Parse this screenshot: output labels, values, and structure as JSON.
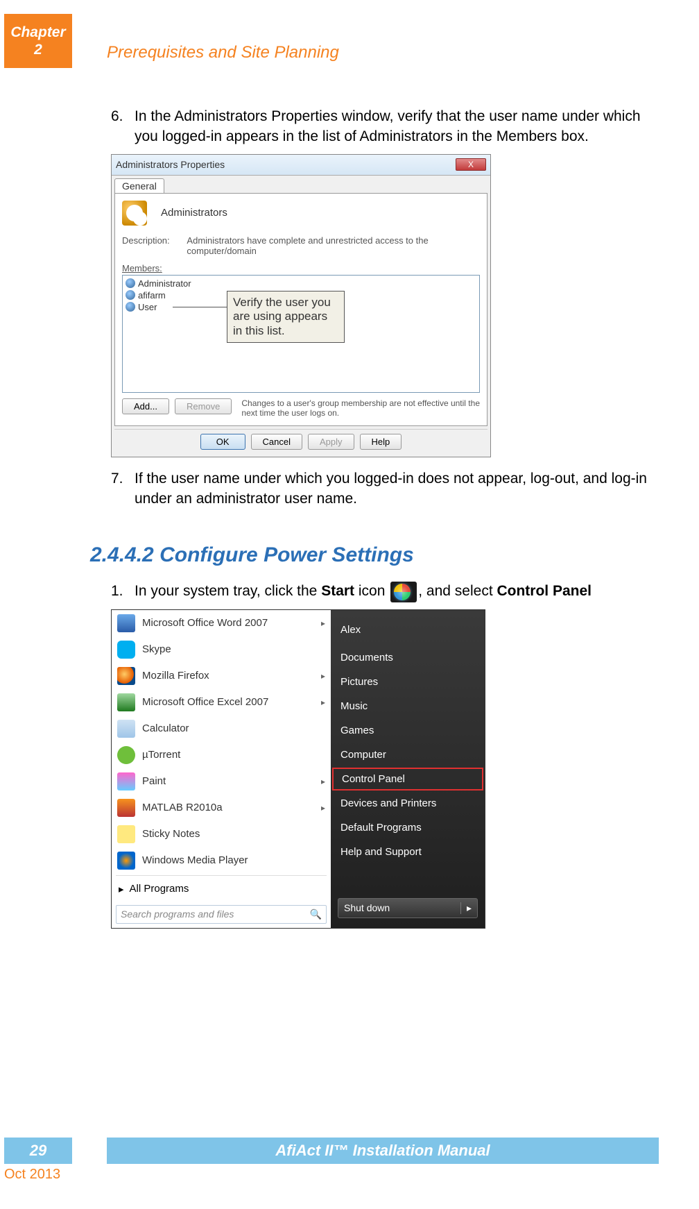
{
  "header": {
    "chapter_label": "Chapter",
    "chapter_num": "2",
    "title": "Prerequisites and Site Planning"
  },
  "step6": {
    "num": "6.",
    "text": "In the Administrators Properties window, verify that the user name under which you logged-in appears in the list of Administrators in the Members box."
  },
  "admin_win": {
    "title": "Administrators Properties",
    "close": "X",
    "tab": "General",
    "group_name": "Administrators",
    "desc_label": "Description:",
    "desc_text": "Administrators have complete and unrestricted access to the computer/domain",
    "members_label": "Members:",
    "members": [
      "Administrator",
      "afifarm",
      "User"
    ],
    "callout": "Verify the user you are using appears in this list.",
    "add": "Add...",
    "remove": "Remove",
    "hint": "Changes to a user's group membership are not effective until the next time the user logs on.",
    "ok": "OK",
    "cancel": "Cancel",
    "apply": "Apply",
    "help": "Help"
  },
  "step7": {
    "num": "7.",
    "text": "If the user name under which you logged-in does not appear, log-out, and log-in under an administrator user name."
  },
  "section": "2.4.4.2 Configure Power Settings",
  "step1": {
    "num": "1.",
    "pre": "In your system tray, click the ",
    "start_bold": "Start",
    "mid": " icon ",
    "post": ", and select ",
    "cp_bold": "Control Panel"
  },
  "start_menu": {
    "left": [
      {
        "label": "Microsoft Office Word 2007",
        "arrow": true,
        "icon": "ic-word"
      },
      {
        "label": "Skype",
        "arrow": false,
        "icon": "ic-skype"
      },
      {
        "label": "Mozilla Firefox",
        "arrow": true,
        "icon": "ic-ff"
      },
      {
        "label": "Microsoft Office Excel 2007",
        "arrow": true,
        "icon": "ic-excel"
      },
      {
        "label": "Calculator",
        "arrow": false,
        "icon": "ic-calc"
      },
      {
        "label": "µTorrent",
        "arrow": false,
        "icon": "ic-ut"
      },
      {
        "label": "Paint",
        "arrow": true,
        "icon": "ic-paint"
      },
      {
        "label": "MATLAB R2010a",
        "arrow": true,
        "icon": "ic-matlab"
      },
      {
        "label": "Sticky Notes",
        "arrow": false,
        "icon": "ic-sticky"
      },
      {
        "label": "Windows Media Player",
        "arrow": false,
        "icon": "ic-wmp"
      }
    ],
    "all_programs": "All Programs",
    "search_placeholder": "Search programs and files",
    "right": [
      {
        "label": "Alex",
        "cls": "user"
      },
      {
        "label": "Documents"
      },
      {
        "label": "Pictures"
      },
      {
        "label": "Music"
      },
      {
        "label": "Games"
      },
      {
        "label": "Computer"
      },
      {
        "label": "Control Panel",
        "cls": "highlight"
      },
      {
        "label": "Devices and Printers"
      },
      {
        "label": "Default Programs"
      },
      {
        "label": "Help and Support"
      }
    ],
    "shutdown": "Shut down"
  },
  "footer": {
    "page": "29",
    "title": "AfiAct II™ Installation Manual",
    "date": "Oct 2013"
  }
}
